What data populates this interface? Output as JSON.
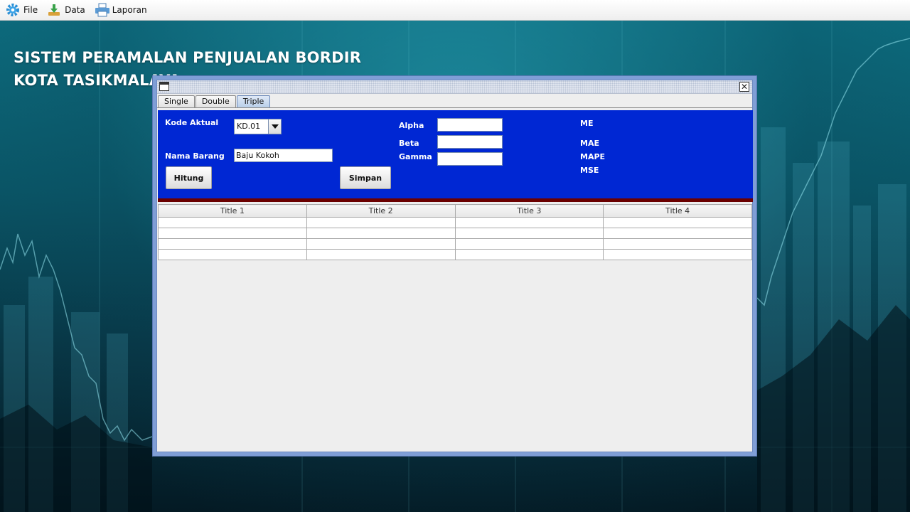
{
  "menubar": {
    "items": [
      {
        "label": "File",
        "icon": "gear-icon"
      },
      {
        "label": "Data",
        "icon": "download-icon"
      },
      {
        "label": "Laporan",
        "icon": "printer-icon"
      }
    ]
  },
  "app": {
    "title_line1": "SISTEM PERAMALAN PENJUALAN BORDIR",
    "title_line2": "KOTA TASIKMALAYA"
  },
  "tabs": [
    {
      "label": "Single",
      "active": false
    },
    {
      "label": "Double",
      "active": false
    },
    {
      "label": "Triple",
      "active": true
    }
  ],
  "form": {
    "kode_label": "Kode Aktual",
    "kode_value": "KD.01",
    "nama_label": "Nama Barang",
    "nama_value": "Baju Kokoh",
    "alpha_label": "Alpha",
    "alpha_value": "",
    "beta_label": "Beta",
    "beta_value": "",
    "gamma_label": "Gamma",
    "gamma_value": "",
    "hitung_label": "Hitung",
    "simpan_label": "Simpan",
    "me_label": "ME",
    "mae_label": "MAE",
    "mape_label": "MAPE",
    "mse_label": "MSE"
  },
  "table": {
    "columns": [
      "Title 1",
      "Title 2",
      "Title 3",
      "Title 4"
    ],
    "rows": [
      [
        "",
        "",
        "",
        ""
      ],
      [
        "",
        "",
        "",
        ""
      ],
      [
        "",
        "",
        "",
        ""
      ],
      [
        "",
        "",
        "",
        ""
      ]
    ]
  },
  "colors": {
    "panel_blue": "#0027d3",
    "panel_border": "#6b0000",
    "frame_border": "#7f9ed6"
  }
}
